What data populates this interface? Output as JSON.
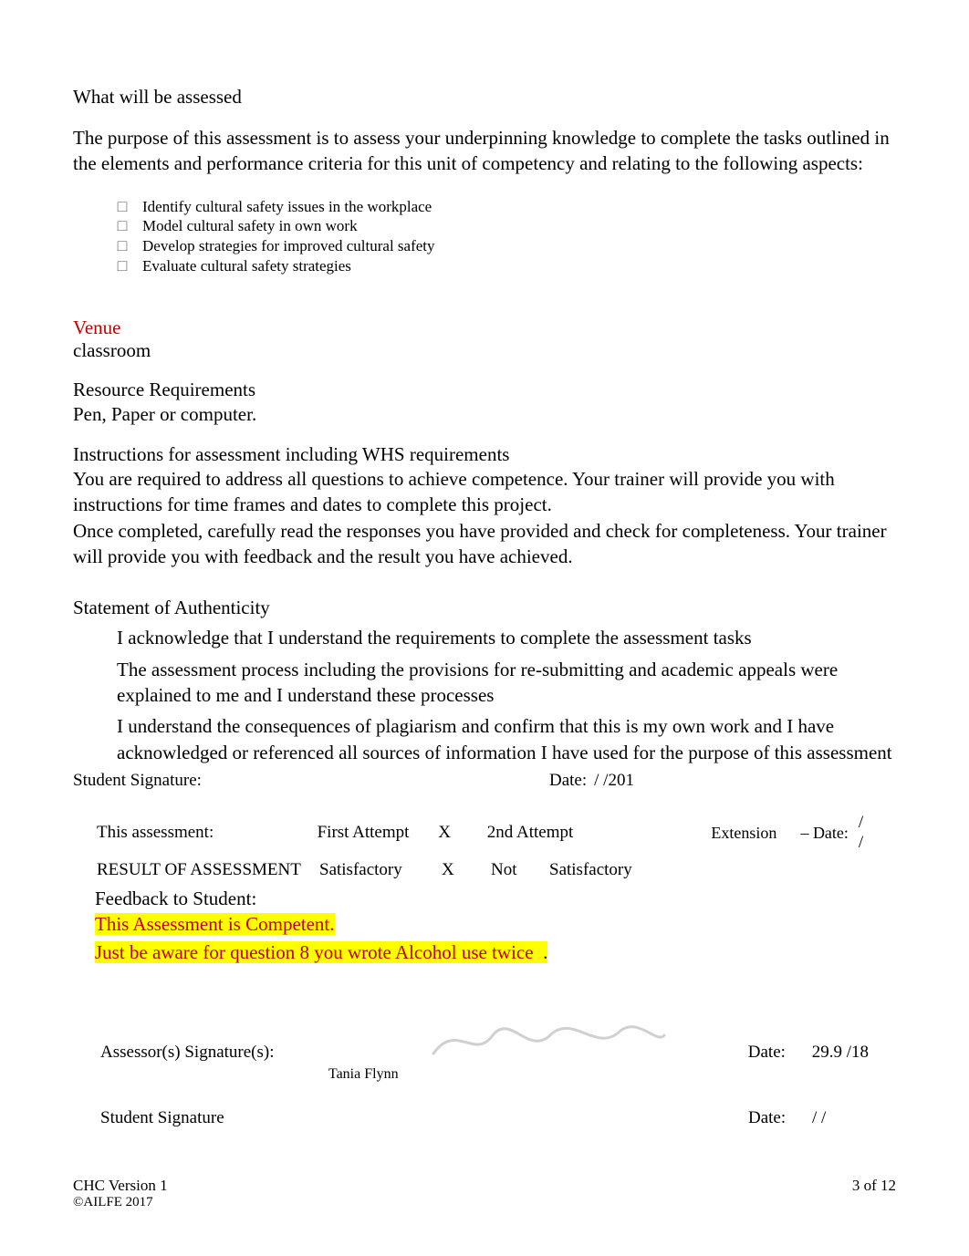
{
  "sections": {
    "whatAssessed": {
      "heading": "What will be assessed",
      "body": "The purpose of this assessment is to assess your underpinning knowledge to complete the tasks outlined in the elements and performance criteria for this unit of competency and relating to the following aspects:",
      "bullets": [
        "Identify cultural safety issues in the workplace",
        "Model cultural safety in own work",
        "Develop strategies for improved cultural safety",
        "Evaluate cultural safety strategies"
      ]
    },
    "venue": {
      "label": "Venue",
      "value": "classroom"
    },
    "resources": {
      "heading": "Resource Requirements",
      "value": "Pen, Paper or computer."
    },
    "instructions": {
      "heading": "Instructions for assessment including WHS requirements",
      "p1": "You are required to address all questions to achieve competence. Your trainer will provide you with instructions for time frames and dates to complete this project.",
      "p2": "Once completed, carefully read the responses you have provided and check for completeness. Your trainer will provide you with feedback and the result you have achieved."
    },
    "soa": {
      "heading": "Statement of Authenticity",
      "items": [
        "I acknowledge that I understand the requirements to complete the assessment tasks",
        "The assessment process including the provisions for re-submitting and academic appeals were explained to me and I understand these processes",
        "I understand the consequences of plagiarism and confirm that this is my own work and I have acknowledged or referenced all sources of information I have used for the purpose of this assessment"
      ]
    },
    "studentSig": {
      "label": "Student Signature:",
      "dateLabel": "Date:",
      "dateVal": "/     /201"
    }
  },
  "assessment": {
    "row1": {
      "label": "This assessment:",
      "c1": "First Attempt",
      "c1x": "X",
      "c2": "2nd Attempt",
      "ext": "Extension",
      "dateLbl": "– Date:",
      "dateVal": "/     /"
    },
    "row2": {
      "label": "RESULT OF ASSESSMENT",
      "c1": "Satisfactory",
      "c1x": "X",
      "c2a": "Not",
      "c2b": "Satisfactory"
    },
    "feedback": {
      "label": "Feedback to Student:",
      "line1": "This Assessment is Competent.",
      "line2": "Just be aware for question 8 you wrote Alcohol use twice",
      "dot": "."
    },
    "assessorSig": {
      "label": "Assessor(s) Signature(s):",
      "name": "Tania Flynn",
      "dateLbl": "Date:",
      "dateVal": "29.9   /18"
    },
    "studentSig2": {
      "label": "Student Signature",
      "dateLbl": "Date:",
      "dateVal": "/     /"
    }
  },
  "footer": {
    "left": "CHC Version 1",
    "copyright": " ©AILFE 2017",
    "right": "3 of 12"
  }
}
